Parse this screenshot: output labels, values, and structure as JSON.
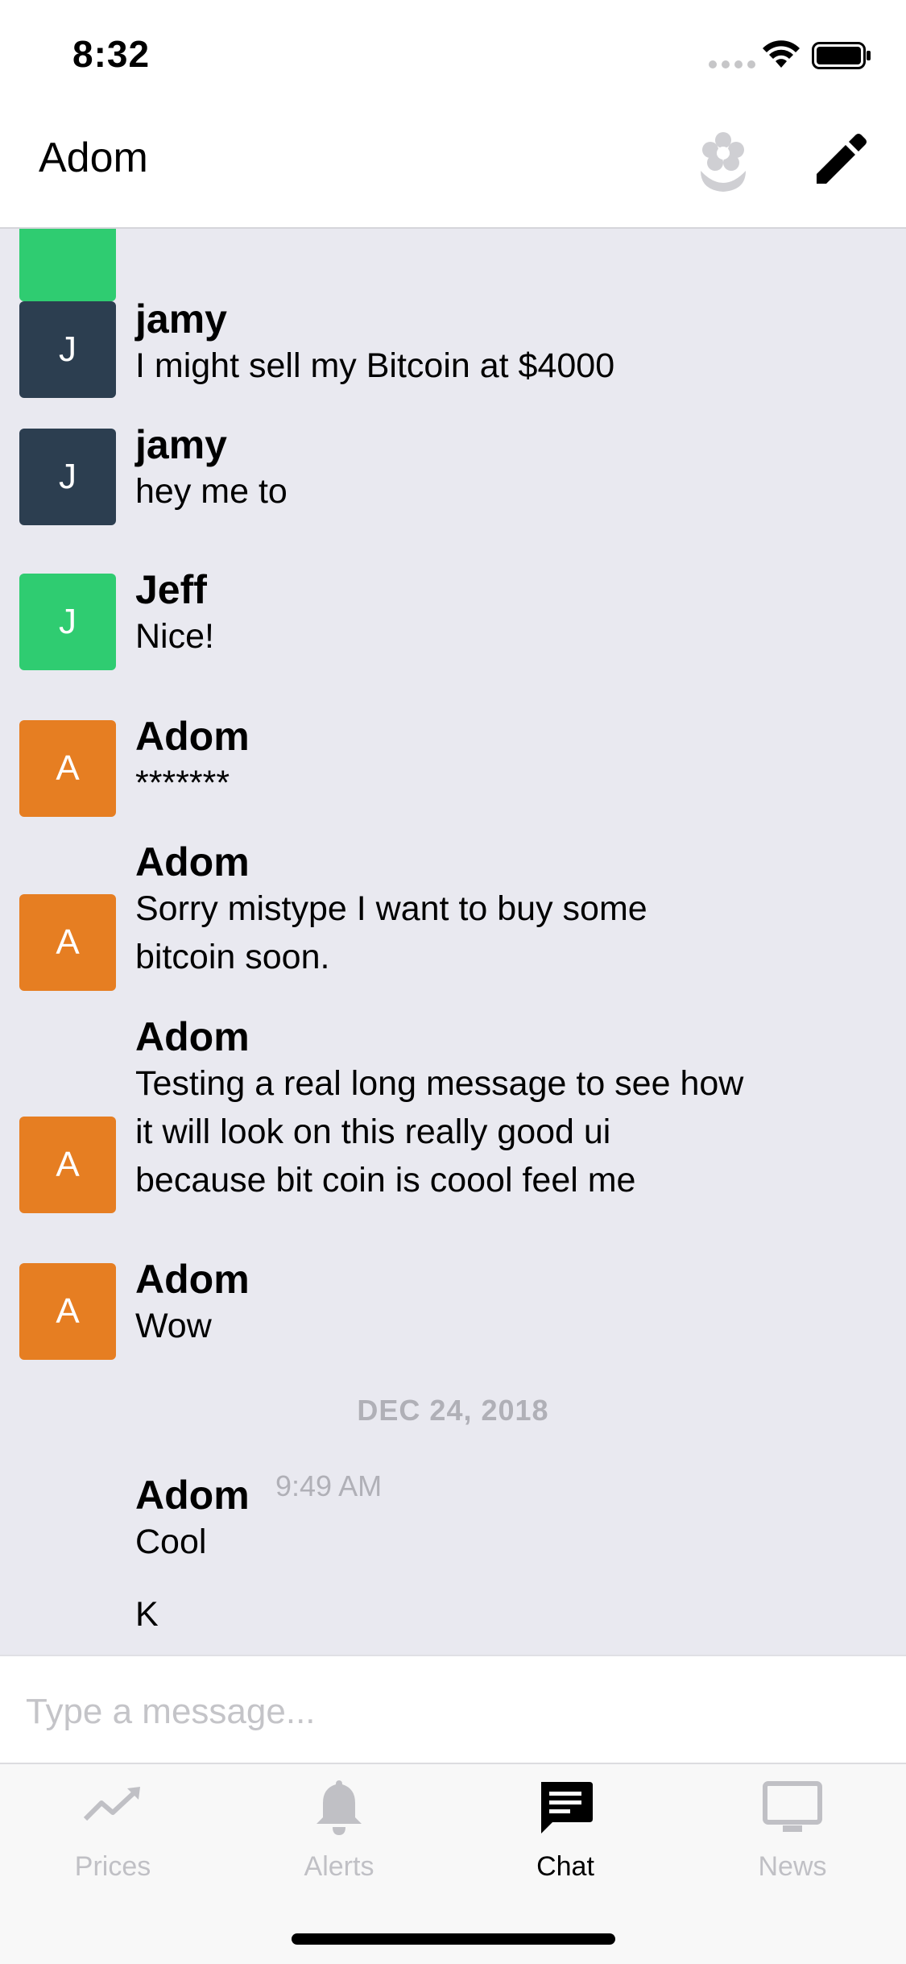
{
  "status_bar": {
    "time": "8:32"
  },
  "header": {
    "title": "Adom",
    "flower_icon": "flower-icon",
    "compose_icon": "pencil-icon"
  },
  "colors": {
    "green": "#2fcc71",
    "navy": "#2c3e50",
    "orange": "#e67e22",
    "chat_bg": "#e9e9f0"
  },
  "messages": [
    {
      "initial": "J",
      "name": "jamy",
      "text": "I might sell my Bitcoin at $4000"
    },
    {
      "initial": "J",
      "name": "jamy",
      "text": "hey me to"
    },
    {
      "initial": "J",
      "name": "Jeff",
      "text": "Nice!"
    },
    {
      "initial": "A",
      "name": "Adom",
      "text": "*******"
    },
    {
      "initial": "A",
      "name": "Adom",
      "text": "Sorry mistype I want to buy some bitcoin soon."
    },
    {
      "initial": "A",
      "name": "Adom",
      "text": "Testing a real long message to see how it will look on this really good ui because bit coin is coool feel me"
    },
    {
      "initial": "A",
      "name": "Adom",
      "text": "Wow"
    }
  ],
  "date_separator": "DEC 24, 2018",
  "last_message": {
    "name": "Adom",
    "time": "9:49 AM",
    "text": "Cool",
    "text2": "K"
  },
  "input": {
    "placeholder": "Type a message..."
  },
  "tabs": [
    {
      "label": "Prices",
      "icon": "chart-icon",
      "active": false
    },
    {
      "label": "Alerts",
      "icon": "bell-icon",
      "active": false
    },
    {
      "label": "Chat",
      "icon": "chat-icon",
      "active": true
    },
    {
      "label": "News",
      "icon": "monitor-icon",
      "active": false
    }
  ]
}
